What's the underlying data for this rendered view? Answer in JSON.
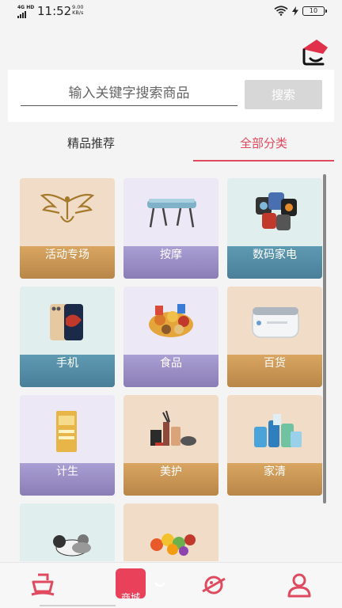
{
  "status_bar": {
    "network": "4G HD",
    "time": "11:52",
    "speed_value": "9.00",
    "speed_unit": "KB/s",
    "battery": "10"
  },
  "search": {
    "placeholder": "输入关键字搜索商品",
    "button_label": "搜索"
  },
  "tabs": [
    {
      "label": "精品推荐",
      "active": false
    },
    {
      "label": "全部分类",
      "active": true
    }
  ],
  "categories": [
    {
      "label": "活动专场",
      "icon": "phoenix-logo-icon"
    },
    {
      "label": "按摩",
      "icon": "massage-table-icon"
    },
    {
      "label": "数码家电",
      "icon": "smartwatches-icon"
    },
    {
      "label": "手机",
      "icon": "smartphone-icon"
    },
    {
      "label": "食品",
      "icon": "snacks-icon"
    },
    {
      "label": "百货",
      "icon": "ultrasonic-cleaner-icon"
    },
    {
      "label": "计生",
      "icon": "condom-box-icon"
    },
    {
      "label": "美护",
      "icon": "cosmetics-icon"
    },
    {
      "label": "家清",
      "icon": "cleaning-products-icon"
    },
    {
      "label": "",
      "icon": "pets-icon"
    },
    {
      "label": "",
      "icon": "fruits-icon"
    }
  ],
  "bottom_nav": [
    {
      "label": "",
      "icon": "ship-icon"
    },
    {
      "label": "商城",
      "icon": "shopping-bag-icon",
      "active": true
    },
    {
      "label": "",
      "icon": "planet-icon"
    },
    {
      "label": "",
      "icon": "user-icon"
    }
  ],
  "colors": {
    "accent": "#e04a5f",
    "label_gold": "#c8934f",
    "label_purple": "#9a8fc6",
    "label_teal": "#548da8"
  }
}
